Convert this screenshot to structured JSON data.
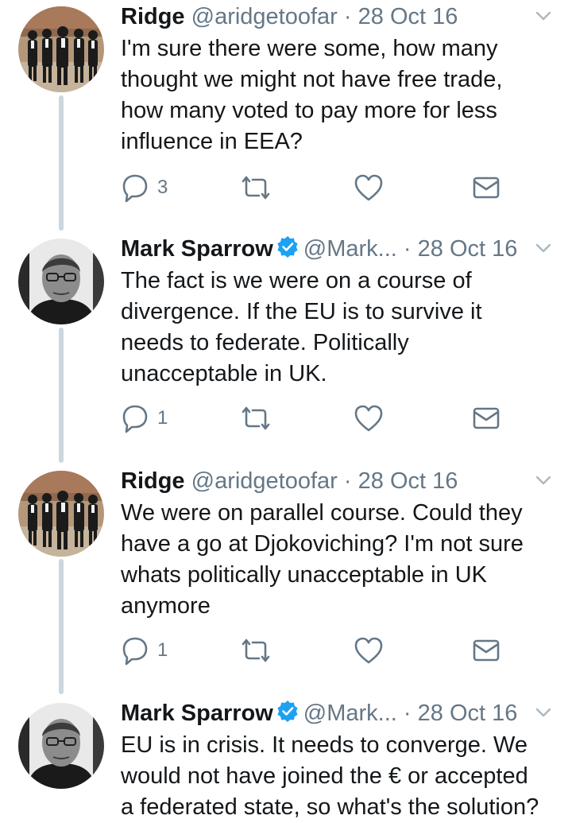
{
  "tweets": [
    {
      "name": "Ridge",
      "handle": "@aridgetoofar",
      "separator": "·",
      "date": "28 Oct 16",
      "verified": false,
      "avatar": "reservoir-dogs-group-avatar",
      "lines": [
        "I'm sure there were some, how many",
        "thought we might not have free trade,",
        "how many voted to pay more for less",
        "influence in EEA?"
      ],
      "reply_count": "3"
    },
    {
      "name": "Mark Sparrow",
      "handle": "@Mark...",
      "separator": "·",
      "date": "28 Oct 16",
      "verified": true,
      "avatar": "man-with-glasses-avatar",
      "lines": [
        "The fact is we were on a course of",
        "divergence. If the EU is to survive it",
        "needs to federate. Politically",
        "unacceptable in UK."
      ],
      "reply_count": "1"
    },
    {
      "name": "Ridge",
      "handle": "@aridgetoofar",
      "separator": "·",
      "date": "28 Oct 16",
      "verified": false,
      "avatar": "reservoir-dogs-group-avatar",
      "lines": [
        "We were on parallel course. Could they",
        "have a go at Djokoviching? I'm not sure",
        "whats politically unacceptable in UK",
        "anymore"
      ],
      "reply_count": "1"
    },
    {
      "name": "Mark Sparrow",
      "handle": "@Mark...",
      "separator": "·",
      "date": "28 Oct 16",
      "verified": true,
      "avatar": "man-with-glasses-avatar",
      "lines": [
        "EU is in crisis. It needs to converge. We",
        "would not have joined the € or accepted",
        "a federated state, so what's the solution?"
      ],
      "reply_count": ""
    }
  ],
  "icons": {
    "reply": "reply-icon",
    "retweet": "retweet-icon",
    "like": "heart-icon",
    "dm": "envelope-icon",
    "menu": "chevron-down-icon",
    "verified": "verified-badge-icon"
  },
  "colors": {
    "text": "#14171a",
    "muted": "#657786",
    "verified": "#1da1f2",
    "thread_line": "#ccd6dd"
  }
}
